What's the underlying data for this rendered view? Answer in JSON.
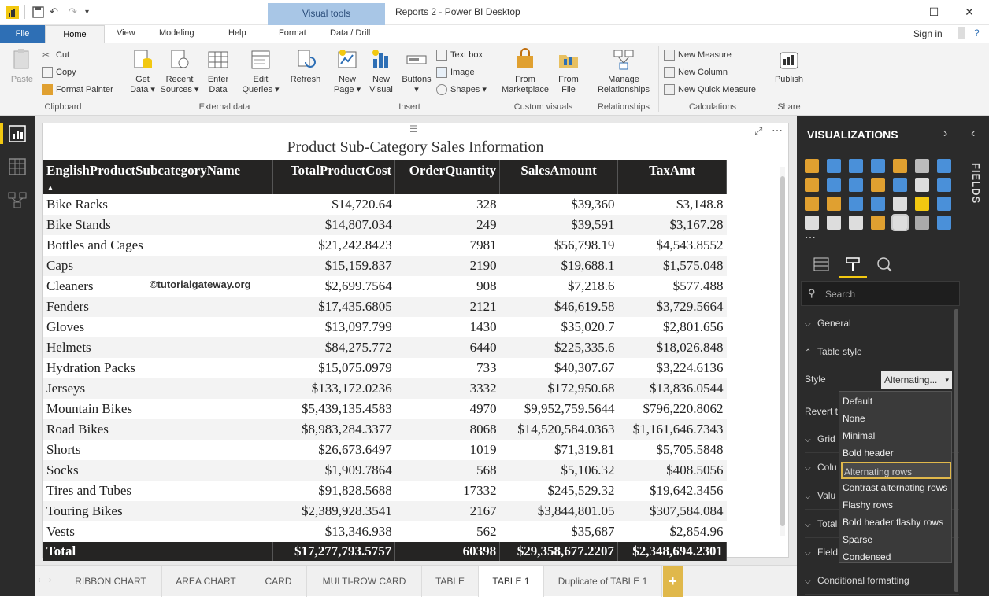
{
  "window": {
    "title": "Reports 2 - Power BI Desktop",
    "context_tab_band": "Visual tools",
    "signin": "Sign in"
  },
  "ribbon_tabs": [
    "File",
    "Home",
    "View",
    "Modeling",
    "Help",
    "Format",
    "Data / Drill"
  ],
  "ribbon": {
    "clipboard": {
      "paste": "Paste",
      "cut": "Cut",
      "copy": "Copy",
      "format_painter": "Format Painter",
      "label": "Clipboard"
    },
    "external": {
      "get_data": "Get\nData",
      "recent_sources": "Recent\nSources",
      "enter_data": "Enter\nData",
      "edit_queries": "Edit\nQueries",
      "refresh": "Refresh",
      "label": "External data"
    },
    "insert": {
      "new_page": "New\nPage",
      "new_visual": "New\nVisual",
      "buttons": "Buttons",
      "text_box": "Text box",
      "image": "Image",
      "shapes": "Shapes",
      "label": "Insert"
    },
    "custom": {
      "from_marketplace": "From\nMarketplace",
      "from_file": "From\nFile",
      "label": "Custom visuals"
    },
    "relationships": {
      "manage": "Manage\nRelationships",
      "label": "Relationships"
    },
    "calculations": {
      "new_measure": "New Measure",
      "new_column": "New Column",
      "new_quick_measure": "New Quick Measure",
      "label": "Calculations"
    },
    "share": {
      "publish": "Publish",
      "label": "Share"
    }
  },
  "report": {
    "title": "Product Sub-Category Sales Information",
    "watermark": "©tutorialgateway.org",
    "columns": [
      "EnglishProductSubcategoryName",
      "TotalProductCost",
      "OrderQuantity",
      "SalesAmount",
      "TaxAmt"
    ],
    "rows": [
      [
        "Bike Racks",
        "$14,720.64",
        "328",
        "$39,360",
        "$3,148.8"
      ],
      [
        "Bike Stands",
        "$14,807.034",
        "249",
        "$39,591",
        "$3,167.28"
      ],
      [
        "Bottles and Cages",
        "$21,242.8423",
        "7981",
        "$56,798.19",
        "$4,543.8552"
      ],
      [
        "Caps",
        "$15,159.837",
        "2190",
        "$19,688.1",
        "$1,575.048"
      ],
      [
        "Cleaners",
        "$2,699.7564",
        "908",
        "$7,218.6",
        "$577.488"
      ],
      [
        "Fenders",
        "$17,435.6805",
        "2121",
        "$46,619.58",
        "$3,729.5664"
      ],
      [
        "Gloves",
        "$13,097.799",
        "1430",
        "$35,020.7",
        "$2,801.656"
      ],
      [
        "Helmets",
        "$84,275.772",
        "6440",
        "$225,335.6",
        "$18,026.848"
      ],
      [
        "Hydration Packs",
        "$15,075.0979",
        "733",
        "$40,307.67",
        "$3,224.6136"
      ],
      [
        "Jerseys",
        "$133,172.0236",
        "3332",
        "$172,950.68",
        "$13,836.0544"
      ],
      [
        "Mountain Bikes",
        "$5,439,135.4583",
        "4970",
        "$9,952,759.5644",
        "$796,220.8062"
      ],
      [
        "Road Bikes",
        "$8,983,284.3377",
        "8068",
        "$14,520,584.0363",
        "$1,161,646.7343"
      ],
      [
        "Shorts",
        "$26,673.6497",
        "1019",
        "$71,319.81",
        "$5,705.5848"
      ],
      [
        "Socks",
        "$1,909.7864",
        "568",
        "$5,106.32",
        "$408.5056"
      ],
      [
        "Tires and Tubes",
        "$91,828.5688",
        "17332",
        "$245,529.32",
        "$19,642.3456"
      ],
      [
        "Touring Bikes",
        "$2,389,928.3541",
        "2167",
        "$3,844,801.05",
        "$307,584.084"
      ],
      [
        "Vests",
        "$13,346.938",
        "562",
        "$35,687",
        "$2,854.96"
      ]
    ],
    "total": [
      "Total",
      "$17,277,793.5757",
      "60398",
      "$29,358,677.2207",
      "$2,348,694.2301"
    ]
  },
  "page_tabs": [
    "RIBBON CHART",
    "AREA CHART",
    "CARD",
    "MULTI-ROW CARD",
    "TABLE",
    "TABLE 1",
    "Duplicate of TABLE 1"
  ],
  "active_page_tab": "TABLE 1",
  "pane": {
    "title": "VISUALIZATIONS",
    "fields_label": "FIELDS",
    "search_placeholder": "Search",
    "sections": {
      "general": "General",
      "table_style": "Table style",
      "style_label": "Style",
      "style_value": "Alternating...",
      "revert": "Revert t",
      "grid": "Grid",
      "column": "Colu",
      "values": "Valu",
      "total": "Total",
      "field": "Field",
      "conditional": "Conditional formatting"
    },
    "style_options": [
      "Default",
      "None",
      "Minimal",
      "Bold header",
      "Alternating rows",
      "Contrast alternating rows",
      "Flashy rows",
      "Bold header flashy rows",
      "Sparse",
      "Condensed"
    ],
    "selected_option": "Alternating rows"
  }
}
